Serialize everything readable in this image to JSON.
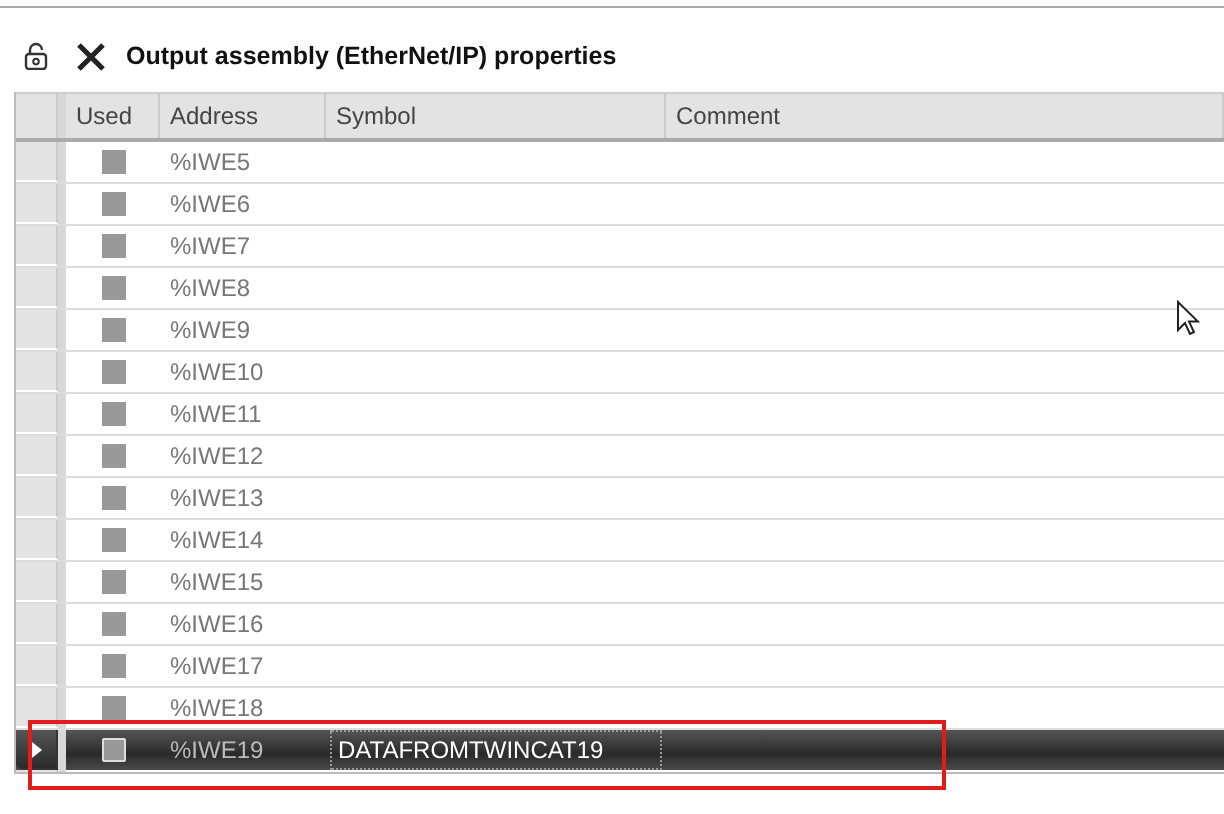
{
  "title": "Output assembly (EtherNet/IP) properties",
  "table": {
    "columns": [
      "Used",
      "Address",
      "Symbol",
      "Comment"
    ],
    "rows": [
      {
        "used": false,
        "address": "%IWE5",
        "selected": false
      },
      {
        "used": false,
        "address": "%IWE6",
        "selected": false
      },
      {
        "used": false,
        "address": "%IWE7",
        "selected": false
      },
      {
        "used": false,
        "address": "%IWE8",
        "selected": false
      },
      {
        "used": false,
        "address": "%IWE9",
        "selected": false
      },
      {
        "used": false,
        "address": "%IWE10",
        "selected": false
      },
      {
        "used": false,
        "address": "%IWE11",
        "selected": false
      },
      {
        "used": false,
        "address": "%IWE12",
        "selected": false
      },
      {
        "used": false,
        "address": "%IWE13",
        "selected": false
      },
      {
        "used": false,
        "address": "%IWE14",
        "selected": false
      },
      {
        "used": false,
        "address": "%IWE15",
        "selected": false
      },
      {
        "used": false,
        "address": "%IWE16",
        "selected": false
      },
      {
        "used": false,
        "address": "%IWE17",
        "selected": false
      },
      {
        "used": false,
        "address": "%IWE18",
        "selected": false
      },
      {
        "used": false,
        "address": "%IWE19",
        "symbol": "DATAFROMTWINCAT19",
        "selected": true
      }
    ]
  }
}
